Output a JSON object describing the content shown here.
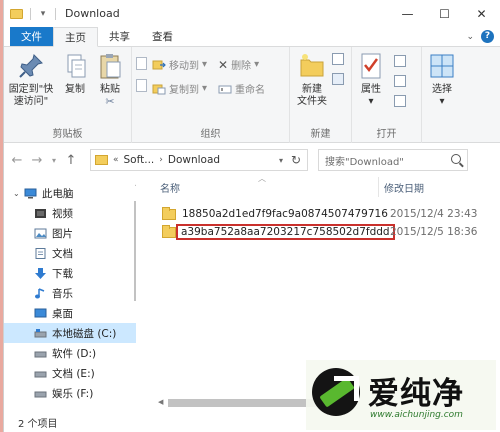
{
  "window": {
    "title": "Download",
    "controls": {
      "minimize": "—",
      "maximize": "☐",
      "close": "✕"
    }
  },
  "tabs": [
    {
      "label": "文件"
    },
    {
      "label": "主页"
    },
    {
      "label": "共享"
    },
    {
      "label": "查看"
    }
  ],
  "ribbon": {
    "clipboard": {
      "label": "剪贴板",
      "pin": "固定到\"快\n速访问\"",
      "copy": "复制",
      "paste": "粘贴"
    },
    "organize": {
      "label": "组织",
      "move_to": "移动到",
      "copy_to": "复制到",
      "delete": "删除",
      "rename": "重命名"
    },
    "new": {
      "label": "新建",
      "new_folder": "新建\n文件夹"
    },
    "open": {
      "label": "打开",
      "properties": "属性"
    },
    "select": {
      "label": "选择"
    }
  },
  "address": {
    "crumbs": [
      "Soft...",
      "Download"
    ],
    "prefix": "«",
    "search_placeholder": "搜索\"Download\""
  },
  "nav": {
    "items": [
      {
        "label": "此电脑",
        "icon": "computer-icon",
        "level": 0
      },
      {
        "label": "视频",
        "icon": "video-icon",
        "level": 1
      },
      {
        "label": "图片",
        "icon": "pictures-icon",
        "level": 1
      },
      {
        "label": "文档",
        "icon": "documents-icon",
        "level": 1
      },
      {
        "label": "下载",
        "icon": "download-icon",
        "level": 1
      },
      {
        "label": "音乐",
        "icon": "music-icon",
        "level": 1
      },
      {
        "label": "桌面",
        "icon": "desktop-icon",
        "level": 1
      },
      {
        "label": "本地磁盘 (C:)",
        "icon": "drive-c-icon",
        "level": 1,
        "selected": true
      },
      {
        "label": "软件 (D:)",
        "icon": "drive-icon",
        "level": 1
      },
      {
        "label": "文档 (E:)",
        "icon": "drive-icon",
        "level": 1
      },
      {
        "label": "娱乐 (F:)",
        "icon": "drive-icon",
        "level": 1
      }
    ]
  },
  "columns": {
    "name": "名称",
    "date": "修改日期"
  },
  "files": [
    {
      "name": "18850a2d1ed7f9fac9a0874507479716",
      "date": "2015/12/4 23:43",
      "highlighted": false
    },
    {
      "name": "a39ba752a8aa7203217c758502d7fddd",
      "date": "2015/12/5 18:36",
      "highlighted": true
    }
  ],
  "status": {
    "count": "2 个项目"
  },
  "watermark": {
    "brand": "爱纯净",
    "url": "www.aichunjing.com"
  },
  "colors": {
    "accent": "#1979ca",
    "selection": "#cce8ff",
    "highlight_border": "#c9302c",
    "folder": "#f3cd5c"
  }
}
